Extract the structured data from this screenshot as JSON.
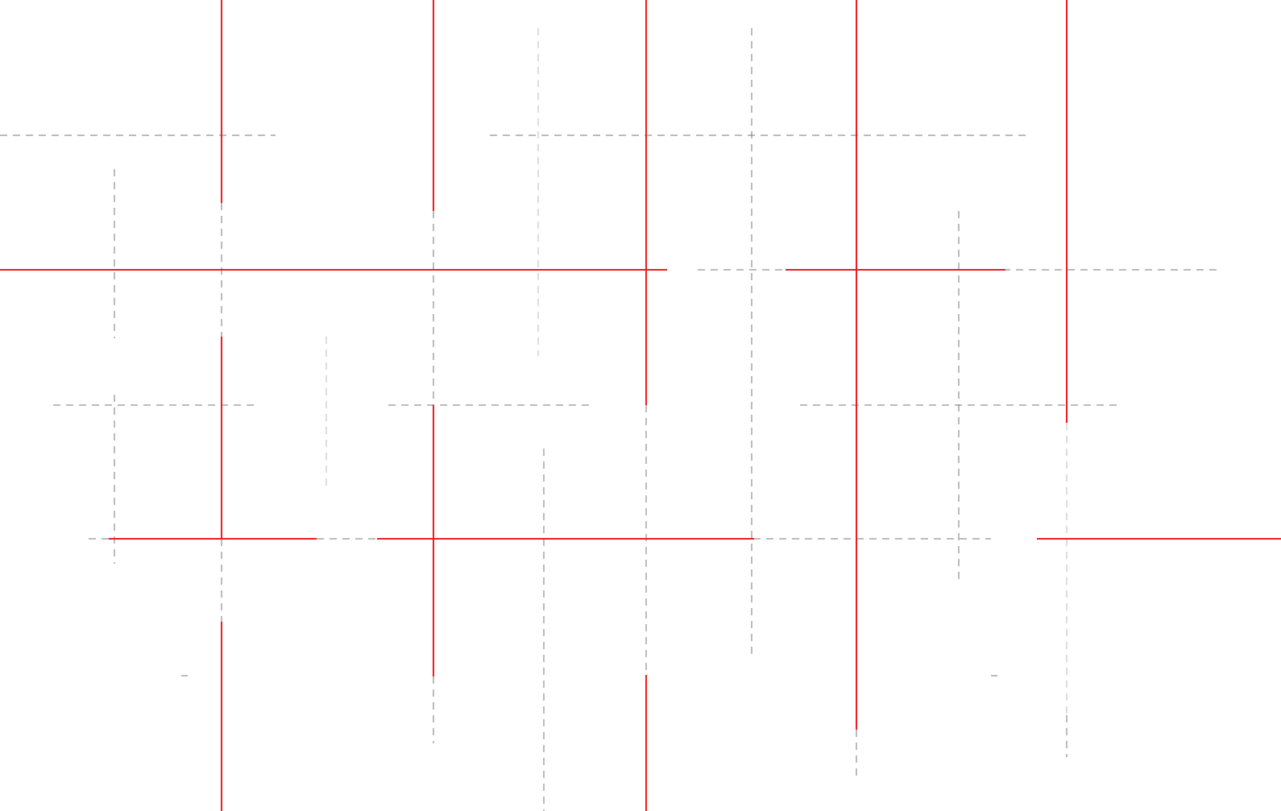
{
  "colors": {
    "background": "#ffffff",
    "highlight_line": "#ee1c1c",
    "guide_line": "#777777",
    "faint_guide_line": "#bbbbbb"
  },
  "description_note": ""
}
